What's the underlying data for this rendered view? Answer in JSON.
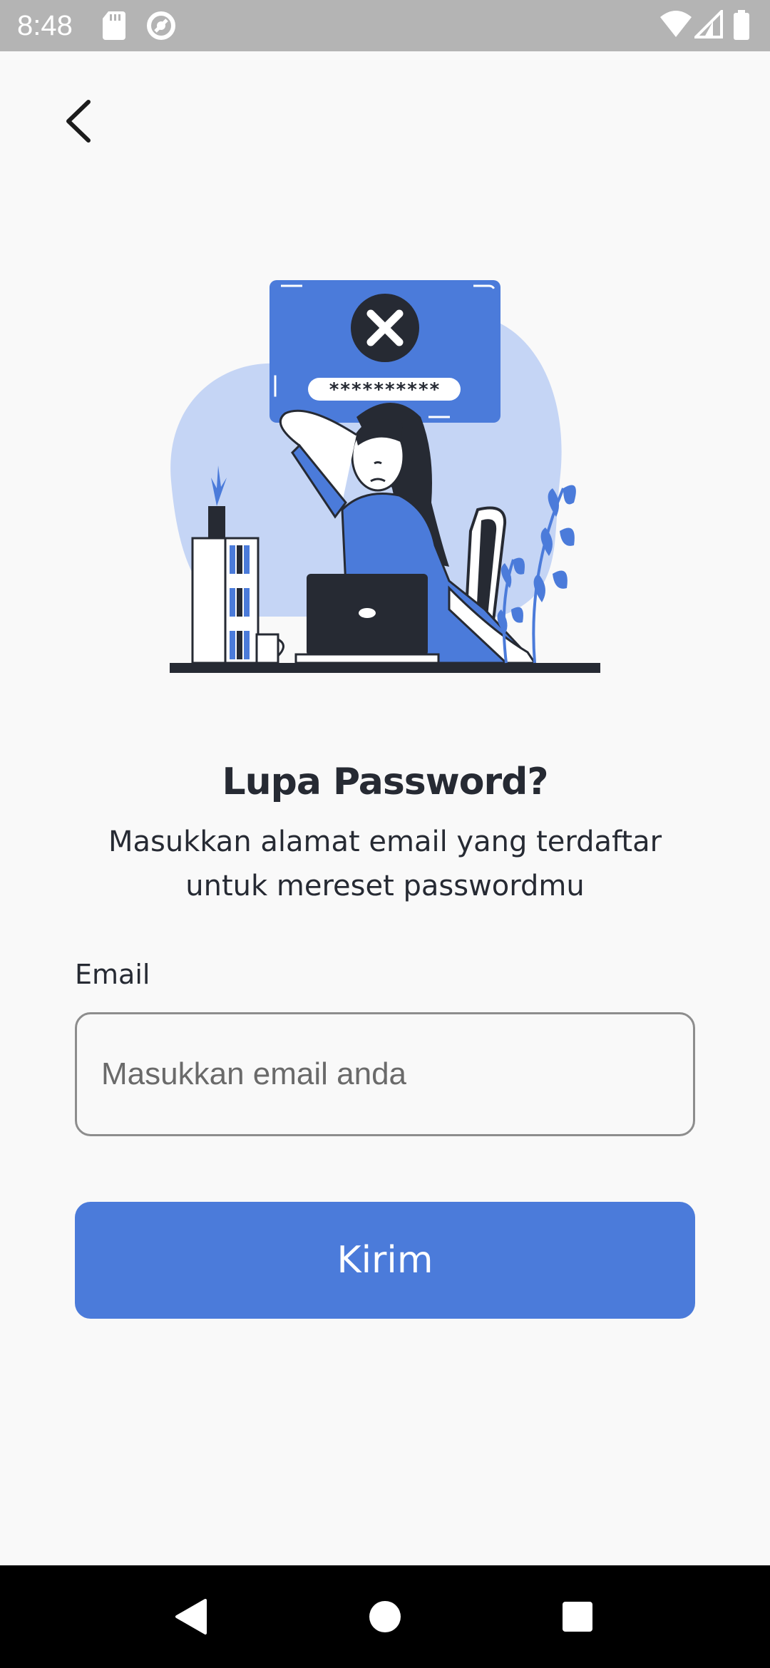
{
  "status_bar": {
    "time": "8:48",
    "left_icons": [
      "sd-card-icon",
      "no-disturb-icon"
    ],
    "right_icons": [
      "wifi-icon",
      "signal-icon",
      "battery-icon"
    ]
  },
  "header": {
    "back_icon": "chevron-left-icon"
  },
  "illustration": {
    "password_mask": "**********",
    "accent_color": "#4b7bda",
    "blob_color": "#c5d5f5",
    "dark_color": "#262a33"
  },
  "content": {
    "title": "Lupa Password?",
    "subtitle_line1": "Masukkan alamat email yang terdaftar",
    "subtitle_line2": "untuk mereset passwordmu"
  },
  "form": {
    "email_label": "Email",
    "email_value": "",
    "email_placeholder": "Masukkan email anda",
    "submit_label": "Kirim",
    "button_color": "#4b7bda"
  },
  "nav_bar": {
    "back": "triangle-back-icon",
    "home": "circle-home-icon",
    "recents": "square-recents-icon"
  }
}
